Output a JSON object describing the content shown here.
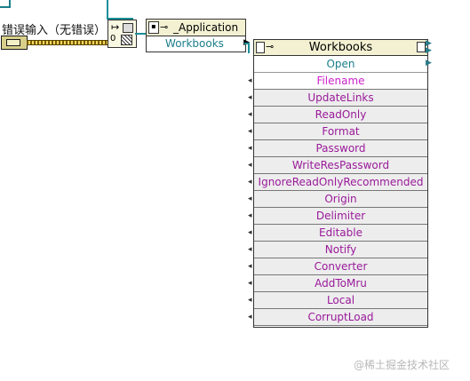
{
  "error_input": {
    "label": "错误输入（无错误）"
  },
  "automation_open": {
    "arrow": "↦",
    "index": "0"
  },
  "application_node": {
    "title": "_Application",
    "property": "Workbooks"
  },
  "workbooks_node": {
    "title": "Workbooks",
    "method": "Open",
    "parameters": [
      "Filename",
      "UpdateLinks",
      "ReadOnly",
      "Format",
      "Password",
      "WriteResPassword",
      "IgnoreReadOnlyRecommended",
      "Origin",
      "Delimiter",
      "Editable",
      "Notify",
      "Converter",
      "AddToMru",
      "Local",
      "CorruptLoad"
    ]
  },
  "watermark": "@稀土掘金技术社区",
  "colors": {
    "property_text": "#1a7f8a",
    "parameter_text": "#9a1a9a",
    "required_parameter_text": "#cc22cc",
    "node_header": "#f3f1d2",
    "error_wire": "#f2d95a",
    "refnum_wire": "#1a8f99"
  },
  "icons": [
    "plug-icon",
    "terminal-arrow-icon",
    "error-cluster-icon"
  ]
}
